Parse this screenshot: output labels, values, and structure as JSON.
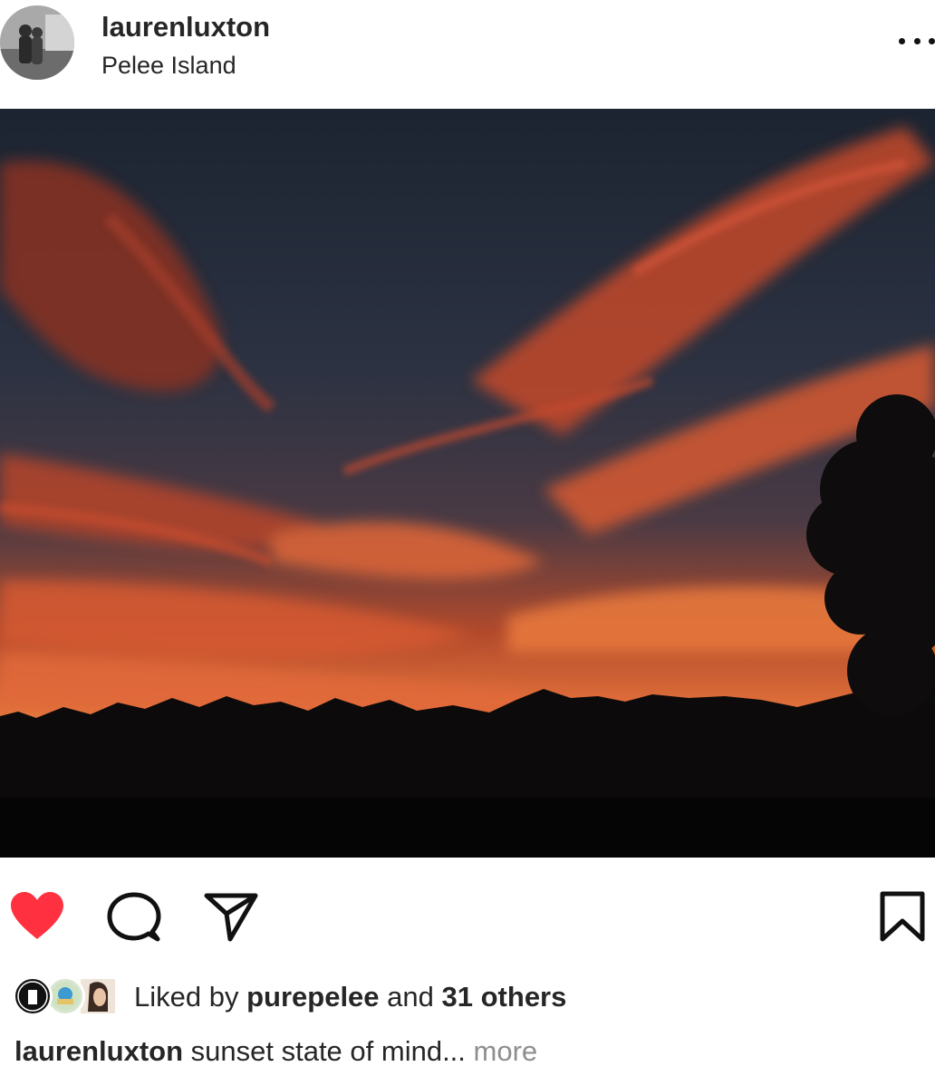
{
  "post": {
    "username": "laurenluxton",
    "location": "Pelee Island"
  },
  "actions": {
    "liked": true,
    "like_color": "#ff3040",
    "icons": [
      "heart-icon",
      "comment-icon",
      "share-icon",
      "bookmark-icon"
    ]
  },
  "likes": {
    "prefix": "Liked by",
    "liker": "purepelee",
    "middle": "and",
    "others": "31 others"
  },
  "caption": {
    "username": "laurenluxton",
    "text": "sunset state of mind...",
    "more": "more"
  }
}
